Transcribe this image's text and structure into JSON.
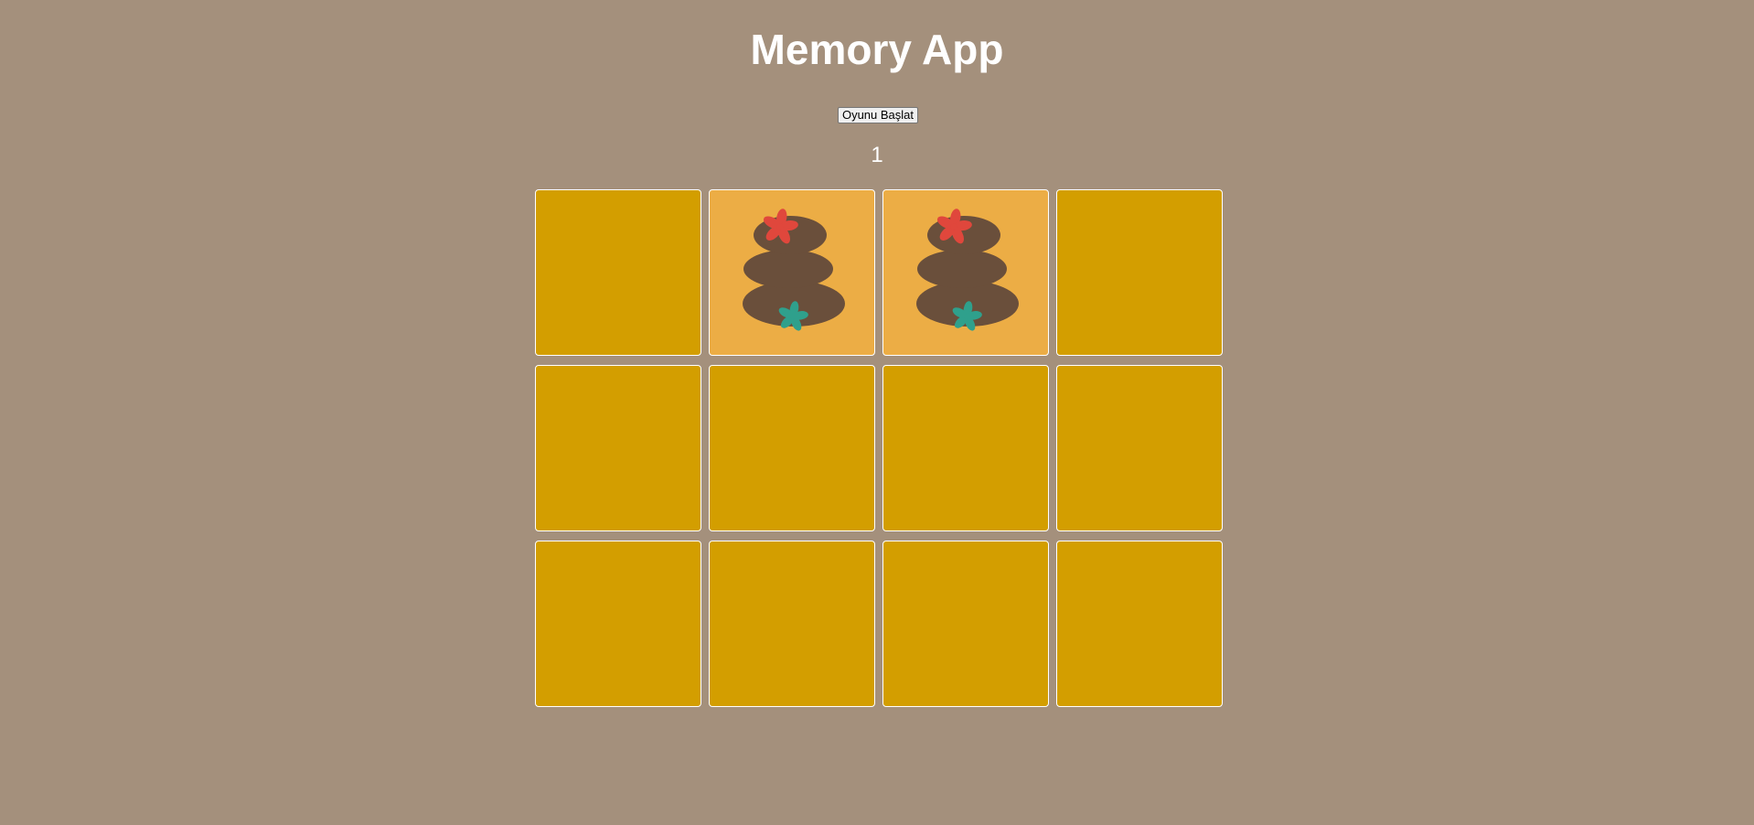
{
  "header": {
    "title": "Memory App"
  },
  "controls": {
    "start_label": "Oyunu Başlat"
  },
  "status": {
    "counter": "1"
  },
  "colors": {
    "background": "#a4907c",
    "card_back": "#d39e00",
    "card_face": "#ecad45",
    "card_border": "#ffffff",
    "stone": "#6a4f3b",
    "flower_red": "#e0473c",
    "flower_teal": "#2fa08c"
  },
  "board": {
    "columns": 4,
    "rows": 3,
    "cards": [
      {
        "state": "face-down",
        "icon": ""
      },
      {
        "state": "face-up",
        "icon": "spa-stones-icon"
      },
      {
        "state": "face-up",
        "icon": "spa-stones-icon"
      },
      {
        "state": "face-down",
        "icon": ""
      },
      {
        "state": "face-down",
        "icon": ""
      },
      {
        "state": "face-down",
        "icon": ""
      },
      {
        "state": "face-down",
        "icon": ""
      },
      {
        "state": "face-down",
        "icon": ""
      },
      {
        "state": "face-down",
        "icon": ""
      },
      {
        "state": "face-down",
        "icon": ""
      },
      {
        "state": "face-down",
        "icon": ""
      },
      {
        "state": "face-down",
        "icon": ""
      }
    ]
  }
}
